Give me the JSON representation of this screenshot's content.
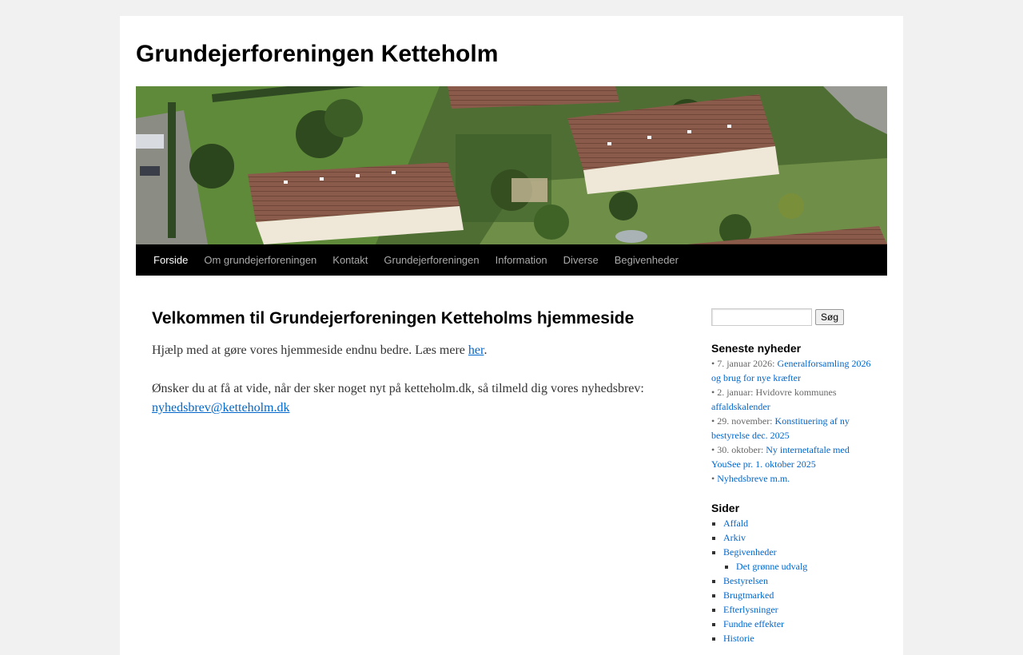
{
  "site": {
    "title": "Grundejerforeningen Ketteholm"
  },
  "nav": {
    "items": [
      {
        "label": "Forside",
        "current": true
      },
      {
        "label": "Om grundejerforeningen"
      },
      {
        "label": "Kontakt"
      },
      {
        "label": "Grundejerforeningen"
      },
      {
        "label": "Information"
      },
      {
        "label": "Diverse"
      },
      {
        "label": "Begivenheder"
      }
    ]
  },
  "main": {
    "heading": "Velkommen til Grundejerforeningen Ketteholms hjemmeside",
    "intro_text": "Hjælp med at gøre vores hjemmeside endnu bedre. Læs mere ",
    "intro_link": "her",
    "intro_end": ".",
    "news_text": "Ønsker du at få at vide, når der sker noget nyt på ketteholm.dk, så tilmeld dig vores nyhedsbrev: ",
    "news_link": "nyhedsbrev@ketteholm.dk"
  },
  "sidebar": {
    "search_button": "Søg",
    "news_title": "Seneste nyheder",
    "news": [
      {
        "prefix": "• 7. januar 2026: ",
        "link": "Generalforsamling 2026 og brug for nye kræfter"
      },
      {
        "prefix": "• 2. januar: Hvidovre kommunes ",
        "link": "affaldskalender"
      },
      {
        "prefix": "• 29. november: ",
        "link": "Konstituering af ny bestyrelse dec. 2025"
      },
      {
        "prefix": "• 30. oktober: ",
        "link": "Ny internetaftale med YouSee pr. 1. oktober 2025"
      },
      {
        "prefix": "• ",
        "link": "Nyhedsbreve m.m."
      }
    ],
    "pages_title": "Sider",
    "pages": [
      "Affald",
      "Arkiv",
      "Begivenheder",
      "Bestyrelsen",
      "Brugtmarked",
      "Efterlysninger",
      "Fundne effekter",
      "Historie"
    ],
    "subpage": "Det grønne udvalg"
  }
}
